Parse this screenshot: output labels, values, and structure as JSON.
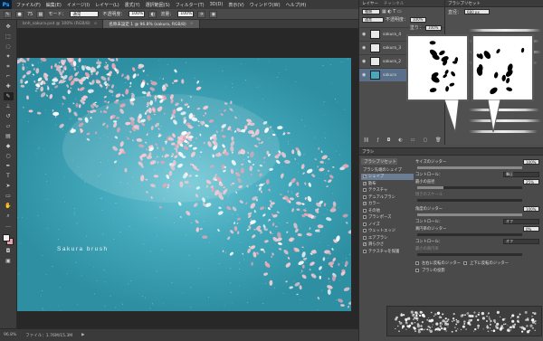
{
  "app": {
    "logo": "Ps"
  },
  "menu": [
    "ファイル(F)",
    "編集(E)",
    "イメージ(I)",
    "レイヤー(L)",
    "書式(Y)",
    "選択範囲(S)",
    "フィルター(T)",
    "3D(D)",
    "表示(V)",
    "ウィンドウ(W)",
    "ヘルプ(H)"
  ],
  "window_controls": [
    "—",
    "□",
    "✕"
  ],
  "options": {
    "brush_size": "75",
    "mode_label": "モード：",
    "mode_value": "通常",
    "opacity_label": "不透明度：",
    "opacity_value": "100%",
    "flow_label": "流量：",
    "flow_value": "100%"
  },
  "tabs": [
    {
      "label": "bnh_sakura.psd @ 100% (RGB/8)",
      "active": false
    },
    {
      "label": "名称未設定 1 @ 96.8% (sakura, RGB/8)",
      "active": true
    }
  ],
  "canvas": {
    "watermark": "Sakura brush"
  },
  "status": {
    "zoom": "96.8%",
    "info": "ファイル：1.76M/15.3M"
  },
  "layers_panel": {
    "title": "レイヤー",
    "tab2": "チャンネル",
    "kind": "種類",
    "blend": "通常",
    "opacity_label": "不透明度：",
    "opacity": "100%",
    "fill_label": "塗り：",
    "fill": "100%",
    "items": [
      "sakura_4",
      "sakura_3",
      "sakura_2",
      "sakura"
    ]
  },
  "preset_panel": {
    "title": "ブラシプリセット",
    "size_label": "直径：",
    "size": "680 px"
  },
  "brush_panel": {
    "title": "ブラシ",
    "tab": "ブラシプリセット",
    "list_header": "ブラシ先端のシェイプ",
    "items": [
      {
        "label": "シェイプ",
        "checked": true,
        "selected": true
      },
      {
        "label": "散布",
        "checked": true,
        "selected": false
      },
      {
        "label": "テクスチャ",
        "checked": false,
        "selected": false
      },
      {
        "label": "デュアルブラシ",
        "checked": false,
        "selected": false
      },
      {
        "label": "カラー",
        "checked": true,
        "selected": false
      },
      {
        "label": "その他",
        "checked": false,
        "selected": false
      },
      {
        "label": "ブラシポーズ",
        "checked": false,
        "selected": false
      },
      {
        "label": "ノイズ",
        "checked": false,
        "selected": false
      },
      {
        "label": "ウェットエッジ",
        "checked": false,
        "selected": false
      },
      {
        "label": "エアブラシ",
        "checked": false,
        "selected": false
      },
      {
        "label": "滑らかさ",
        "checked": true,
        "selected": false
      },
      {
        "label": "テクスチャを保護",
        "checked": false,
        "selected": false
      }
    ],
    "size_jitter_label": "サイズのジッター",
    "size_jitter": "100%",
    "control_label": "コントロール：",
    "control_value": "筆圧",
    "min_diameter_label": "最小の直径",
    "min_diameter": "25%",
    "tilt_scale_label": "傾きのスケール",
    "angle_jitter_label": "角度のジッター",
    "angle_jitter": "100%",
    "control2_value": "オフ",
    "roundness_jitter_label": "真円率のジッター",
    "roundness_jitter": "0%",
    "control3_value": "オフ",
    "min_roundness_label": "最小の真円率",
    "flip_x": "左右に反転のジッター",
    "flip_y": "上下に反転のジッター",
    "projection": "ブラシの投影"
  }
}
